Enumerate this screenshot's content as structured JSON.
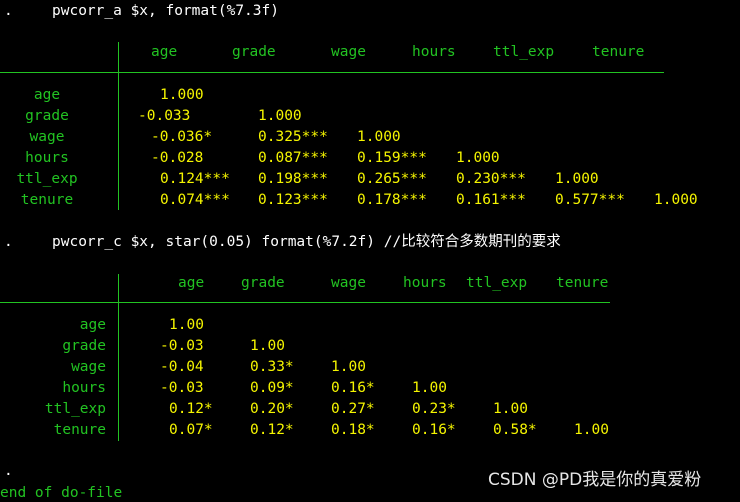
{
  "colors": {
    "background": "#000000",
    "command": "#FFFFFF",
    "label": "#22C322",
    "value": "#F5F500"
  },
  "cmd1": {
    "prompt": ".",
    "text": "pwcorr_a $x, format(%7.3f)"
  },
  "table1": {
    "headers": [
      "age",
      "grade",
      "wage",
      "hours",
      "ttl_exp",
      "tenure"
    ],
    "rows": [
      {
        "label": "age",
        "values": [
          "1.000"
        ]
      },
      {
        "label": "grade",
        "values": [
          "-0.033",
          "1.000"
        ]
      },
      {
        "label": "wage",
        "values": [
          "-0.036*",
          "0.325***",
          "1.000"
        ]
      },
      {
        "label": "hours",
        "values": [
          "-0.028",
          "0.087***",
          "0.159***",
          "1.000"
        ]
      },
      {
        "label": "ttl_exp",
        "values": [
          "0.124***",
          "0.198***",
          "0.265***",
          "0.230***",
          "1.000"
        ]
      },
      {
        "label": "tenure",
        "values": [
          "0.074***",
          "0.123***",
          "0.178***",
          "0.161***",
          "0.577***",
          "1.000"
        ]
      }
    ]
  },
  "cmd2": {
    "prompt": ".",
    "text": "pwcorr_c $x, star(0.05) format(%7.2f) //比较符合多数期刊的要求"
  },
  "table2": {
    "headers": [
      "age",
      "grade",
      "wage",
      "hours",
      "ttl_exp",
      "tenure"
    ],
    "rows": [
      {
        "label": "age",
        "values": [
          "1.00"
        ]
      },
      {
        "label": "grade",
        "values": [
          "-0.03",
          "1.00"
        ]
      },
      {
        "label": "wage",
        "values": [
          "-0.04",
          "0.33*",
          "1.00"
        ]
      },
      {
        "label": "hours",
        "values": [
          "-0.03",
          "0.09*",
          "0.16*",
          "1.00"
        ]
      },
      {
        "label": "ttl_exp",
        "values": [
          "0.12*",
          "0.20*",
          "0.27*",
          "0.23*",
          "1.00"
        ]
      },
      {
        "label": "tenure",
        "values": [
          "0.07*",
          "0.12*",
          "0.18*",
          "0.16*",
          "0.58*",
          "1.00"
        ]
      }
    ]
  },
  "prompt3": ".",
  "end_text": "end of do-file",
  "watermark": "CSDN @PD我是你的真爱粉"
}
